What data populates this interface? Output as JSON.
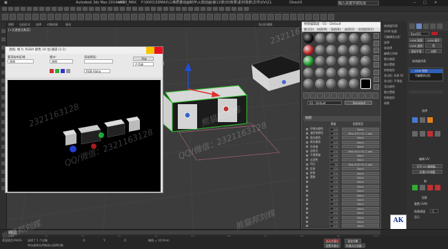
{
  "titlebar": {
    "app": "Autodesk 3ds Max 2014 x64",
    "doc": "AKOO_MAX",
    "path": "F:\\0001\\3DMAX\\三维质量动画制作\\火箭动画\\第12课\\3D效果\\素材场景\\文件\\UV\\21.max",
    "render_engine": "DirectX",
    "right": "输入关键字或短语"
  },
  "ribbon": {
    "items": [
      "建模",
      "自由形式",
      "选择",
      "对象绘制",
      "填充"
    ],
    "right": "多边形建模"
  },
  "viewport": {
    "label": "[+][透视][真实]"
  },
  "render_window": {
    "title": "透视, 帧 0, RGBA 颜色 16 位/通道 (1:1)",
    "area_label": "要渲染的区域:",
    "area_value": "视图",
    "viewport_label": "视口:",
    "viewport_value": "透视",
    "preset_label": "渲染预设:",
    "preset_value": "",
    "render_btn": "渲染",
    "product": "产品级",
    "channel": "RGB Alpha"
  },
  "material_editor": {
    "title": "材质编辑器 - 03 - Default",
    "menu": [
      "模式(D)",
      "材质(M)",
      "导航(N)",
      "选项(O)",
      "实用程序(U)"
    ],
    "material_name": "03 - Default",
    "material_type": "Standard",
    "maps_header": "贴图",
    "col_amount": "数量",
    "col_map": "贴图类型",
    "maps": [
      {
        "name": "环境光颜色",
        "amount": "100",
        "map": "None"
      },
      {
        "name": "漫反射颜色",
        "amount": "100",
        "map": "Map #15 (01-1.jpg)"
      },
      {
        "name": "高光颜色",
        "amount": "100",
        "map": "None"
      },
      {
        "name": "高光级别",
        "amount": "100",
        "map": "None"
      },
      {
        "name": "光泽度",
        "amount": "100",
        "map": "None"
      },
      {
        "name": "自发光",
        "amount": "100",
        "map": "Map #14 (01-1.jpg)"
      },
      {
        "name": "不透明度",
        "amount": "100",
        "map": "None"
      },
      {
        "name": "过滤色",
        "amount": "100",
        "map": "None"
      },
      {
        "name": "凹凸",
        "amount": "30",
        "map": "Map #16 (01-2.jpg)"
      },
      {
        "name": "反射",
        "amount": "100",
        "map": "None"
      },
      {
        "name": "折射",
        "amount": "100",
        "map": "None"
      },
      {
        "name": "置换",
        "amount": "100",
        "map": "None"
      },
      {
        "name": "",
        "amount": "100",
        "map": "None"
      },
      {
        "name": "",
        "amount": "100",
        "map": "None"
      },
      {
        "name": "",
        "amount": "100",
        "map": "None"
      },
      {
        "name": "",
        "amount": "100",
        "map": "None"
      },
      {
        "name": "",
        "amount": "100",
        "map": "None"
      },
      {
        "name": "",
        "amount": "100",
        "map": "None"
      },
      {
        "name": "",
        "amount": "100",
        "map": "None"
      },
      {
        "name": "",
        "amount": "100",
        "map": "None"
      },
      {
        "name": "",
        "amount": "100",
        "map": "None"
      },
      {
        "name": "",
        "amount": "100",
        "map": "None"
      },
      {
        "name": "",
        "amount": "100",
        "map": "None"
      }
    ]
  },
  "right_column": {
    "items": [
      "修改器列表",
      "UVW 贴图",
      "可编辑多边形",
      "选择",
      "软选择",
      "编辑几何体",
      "细分曲面",
      "细分置换",
      "绘制变形",
      "多边形: 材质 ID",
      "多边形: 平滑组",
      "顶点颜色",
      "细分置换",
      "绘制变形",
      "参数"
    ]
  },
  "command_panel": {
    "object_name": "Box001",
    "list_items": [
      "UVW 贴图",
      "可编辑多边形"
    ],
    "section_select": "选择",
    "section_edit": "编辑 UV",
    "btn_open_uv": "打开 UV 编辑器...",
    "btn_tweak": "在视口中调整",
    "section_seams": "剥",
    "btn_seams": "快速剥",
    "section_projection": "投影",
    "section_wrap": "包裹",
    "section_config": "配置",
    "btn_reset": "重置 UVW",
    "label_channel": "贴图通道",
    "channel_val": "1",
    "label_display": "显示",
    "label_map_seams": "贴图接缝",
    "label_peel_seams": "剥离接缝"
  },
  "timeline": {
    "frame": "0 / 100",
    "ticks": [
      "0",
      "10",
      "20",
      "30",
      "40",
      "50",
      "60",
      "70",
      "80",
      "90",
      "100"
    ]
  },
  "statusbar": {
    "selected": "选择了 1 个对象",
    "hint": "单击或单击并拖动以选择对象",
    "welcome": "欢迎使用 MAXS",
    "x_label": "X:",
    "y_label": "Y:",
    "z_label": "Z:",
    "grid": "栅格 = 10.0mm",
    "autokey": "自动关键点",
    "selection_set": "选定对象",
    "set_key": "设置关键点",
    "key_filter": "关键点过滤器..."
  },
  "watermarks": [
    "QQ/微信",
    "2321163128",
    "熊猫邦刘辉",
    "QQ/微信：2321163128"
  ],
  "logo": "AK",
  "colors": {
    "accent_red": "#e81123",
    "accent_yellow": "#f7c400",
    "green_select": "#2cc22c",
    "blue_axis": "#1f4fd8",
    "red_axis": "#e03030"
  }
}
